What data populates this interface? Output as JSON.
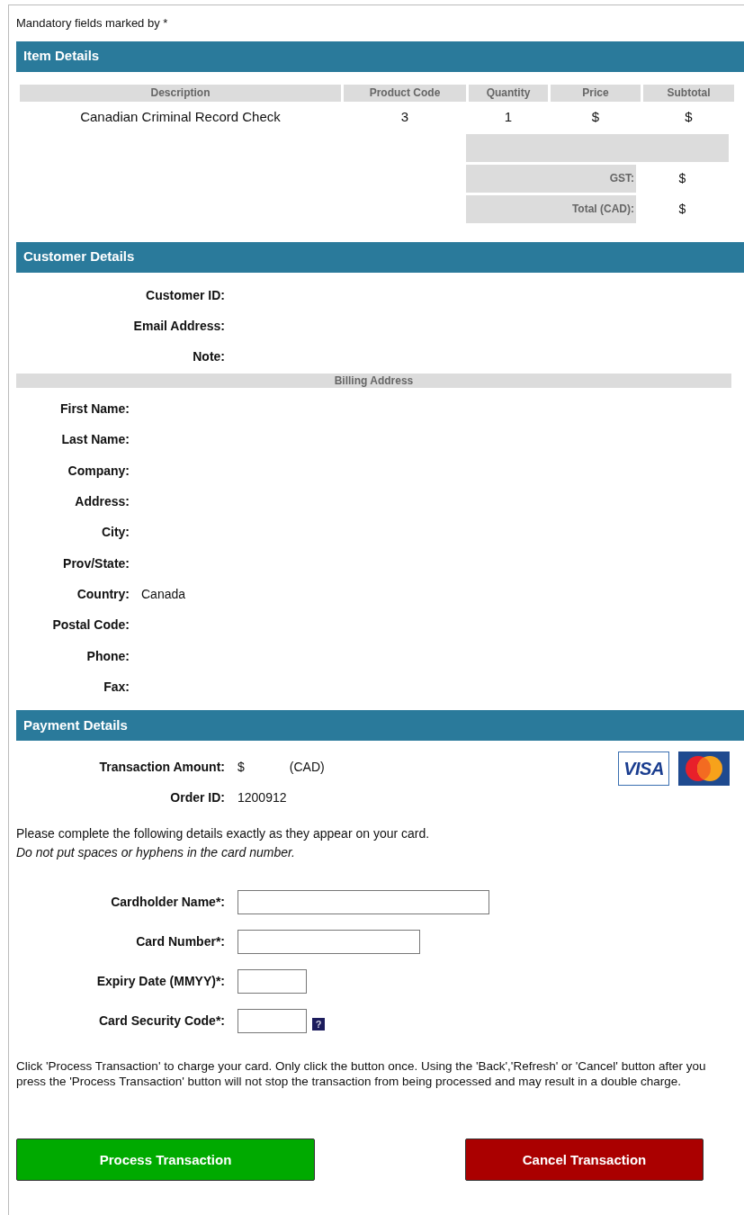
{
  "mandatory_note": "Mandatory fields marked by *",
  "item_details": {
    "title": "Item Details",
    "columns": [
      "Description",
      "Product Code",
      "Quantity",
      "Price",
      "Subtotal"
    ],
    "rows": [
      [
        "Canadian Criminal Record Check",
        "3",
        "1",
        "$",
        "$"
      ]
    ],
    "totals": [
      {
        "label": "GST:",
        "value": "$"
      },
      {
        "label": "Total (CAD):",
        "value": "$"
      }
    ]
  },
  "customer_details": {
    "title": "Customer Details",
    "fields": [
      {
        "label": "Customer ID:"
      },
      {
        "label": "Email Address:"
      },
      {
        "label": "Note:"
      }
    ],
    "billing_title": "Billing Address",
    "billing_fields": [
      {
        "label": "First Name:"
      },
      {
        "label": "Last Name:"
      },
      {
        "label": "Company:"
      },
      {
        "label": "Address:"
      },
      {
        "label": "City:"
      },
      {
        "label": "Prov/State:"
      },
      {
        "label": "Country:",
        "value": "Canada"
      },
      {
        "label": "Postal Code:"
      },
      {
        "label": "Phone:"
      },
      {
        "label": "Fax:"
      }
    ]
  },
  "payment_details": {
    "title": "Payment Details",
    "transaction_amount": {
      "label": "Transaction Amount:",
      "value": "$",
      "currency": "(CAD)"
    },
    "card_logos": [
      {
        "kind": "visa",
        "text": "VISA"
      },
      {
        "kind": "mastercard"
      }
    ],
    "help_mark": "?",
    "order_id": {
      "label": "Order ID:",
      "value": "1200912"
    },
    "instructions": "Please complete the following details exactly as they appear on your card.",
    "instructions_note": "Do not put spaces or hyphens in the card number.",
    "card_fields": [
      {
        "label": "Cardholder Name*:",
        "kind": "long"
      },
      {
        "label": "Card Number*:",
        "kind": "medium"
      },
      {
        "label": "Expiry Date (MMYY)*:",
        "kind": "short"
      },
      {
        "label": "Card Security Code*:",
        "kind": "short_help"
      }
    ],
    "warning": "Click 'Process Transaction' to charge your card. Only click the button once. Using the 'Back','Refresh' or 'Cancel' button after you press the 'Process Transaction' button will not stop the transaction from being processed and may result in a double charge.",
    "buttons": [
      {
        "label": "Process Transaction",
        "kind": "process"
      },
      {
        "label": "Cancel Transaction",
        "kind": "cancel"
      }
    ]
  }
}
